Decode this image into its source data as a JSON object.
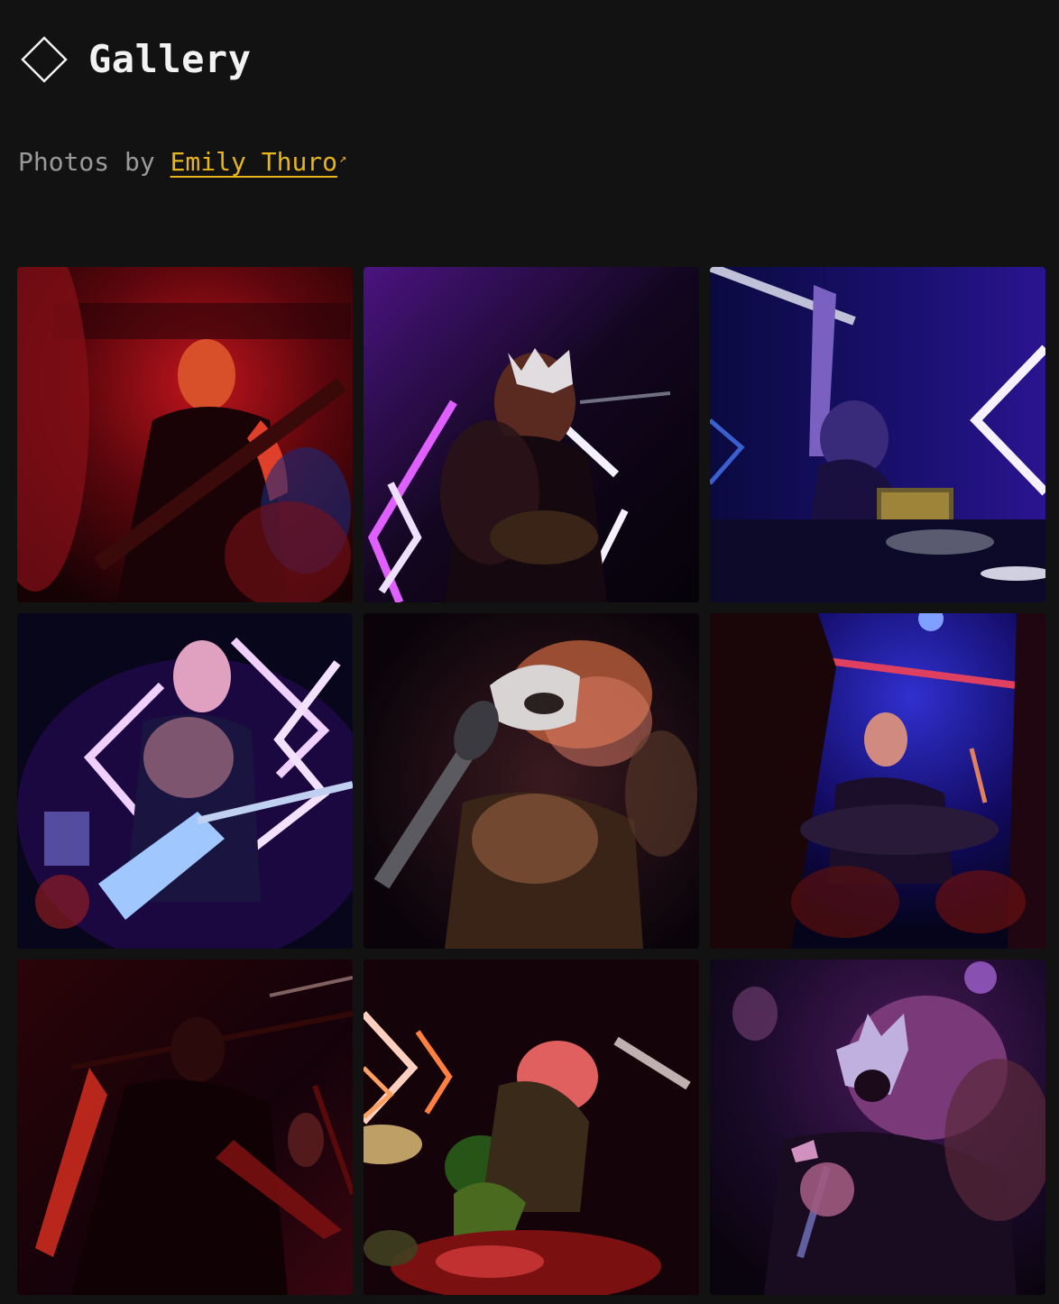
{
  "header": {
    "title": "Gallery",
    "logo_icon": "diamond-outline-icon"
  },
  "credit": {
    "prefix": "Photos by ",
    "photographer": "Emily Thuro",
    "link_icon": "external-link-arrow-icon",
    "link_color": "#e8b51c"
  },
  "theme": {
    "background": "#121212",
    "text": "#f2f2f2",
    "muted": "#9a9a9a",
    "accent": "#e8b51c"
  },
  "gallery": {
    "columns": 3,
    "photos": [
      {
        "subject": "guitarist-red-light",
        "tint": "#b3121a"
      },
      {
        "subject": "masked-singer-guitarist-neon",
        "tint": "#6a16a8"
      },
      {
        "subject": "performer-arm-raised-blue-neon",
        "tint": "#2a1a9e"
      },
      {
        "subject": "bassist-neon-diamonds",
        "tint": "#4a1aa0"
      },
      {
        "subject": "masked-vocalist-motion-blur",
        "tint": "#3a1630"
      },
      {
        "subject": "masked-drummer-blue",
        "tint": "#1a1aa0"
      },
      {
        "subject": "guitarist-silhouette-red",
        "tint": "#5a0a10"
      },
      {
        "subject": "performer-red-orange-neon",
        "tint": "#7a0a0a"
      },
      {
        "subject": "masked-singer-microphone-purple",
        "tint": "#5a1a6a"
      }
    ]
  }
}
